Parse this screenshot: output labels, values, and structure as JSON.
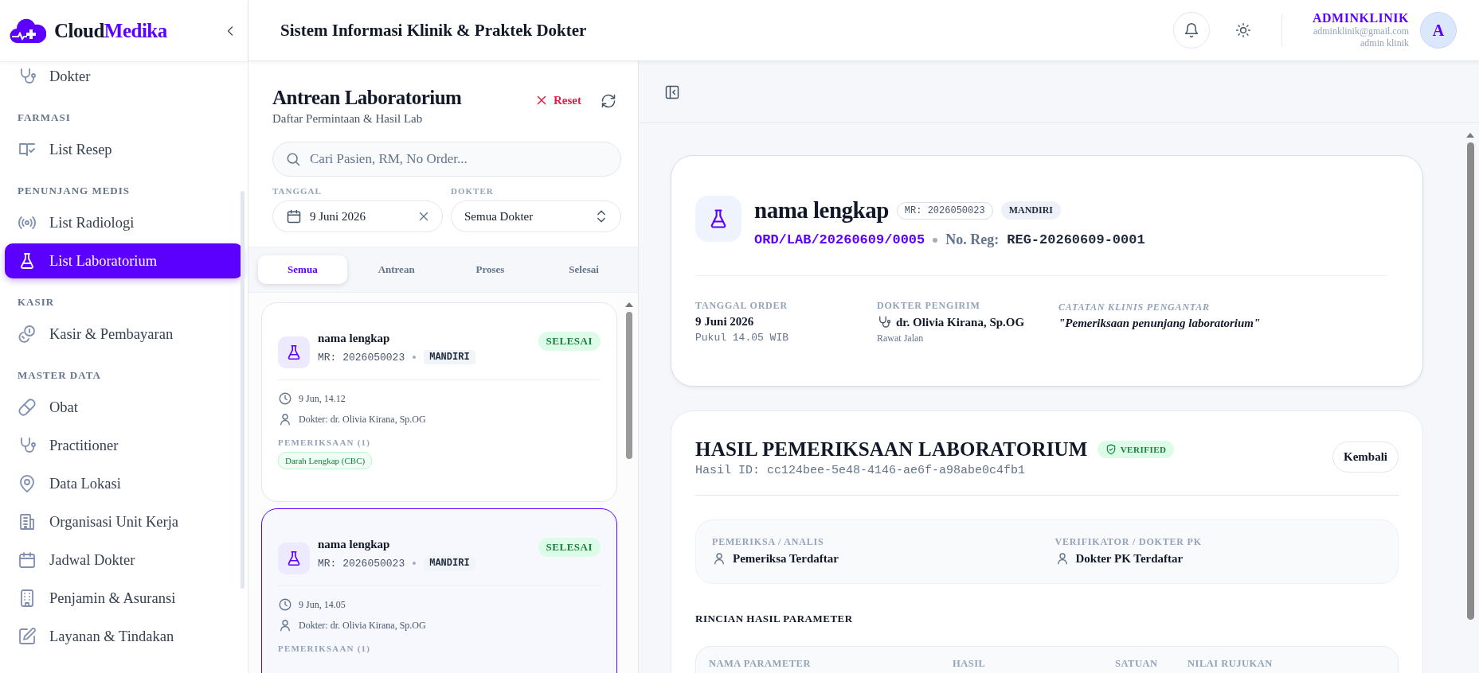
{
  "brand": {
    "name": "Cloud",
    "accent": "Medika"
  },
  "sidebar": {
    "sections": [
      {
        "items": [
          {
            "label": "Dokter",
            "selected": false
          }
        ]
      },
      {
        "heading": "FARMASI",
        "items": [
          {
            "label": "List Resep",
            "selected": false
          }
        ]
      },
      {
        "heading": "PENUNJANG MEDIS",
        "items": [
          {
            "label": "List Radiologi",
            "selected": false
          },
          {
            "label": "List Laboratorium",
            "selected": true
          }
        ]
      },
      {
        "heading": "KASIR",
        "items": [
          {
            "label": "Kasir & Pembayaran",
            "selected": false
          }
        ]
      },
      {
        "heading": "MASTER DATA",
        "items": [
          {
            "label": "Obat",
            "selected": false
          },
          {
            "label": "Practitioner",
            "selected": false
          },
          {
            "label": "Data Lokasi",
            "selected": false
          },
          {
            "label": "Organisasi Unit Kerja",
            "selected": false
          },
          {
            "label": "Jadwal Dokter",
            "selected": false
          },
          {
            "label": "Penjamin & Asuransi",
            "selected": false
          },
          {
            "label": "Layanan & Tindakan",
            "selected": false
          }
        ]
      }
    ]
  },
  "header": {
    "title": "Sistem Informasi Klinik & Praktek Dokter",
    "user": {
      "name": "ADMINKLINIK",
      "email": "adminklinik@gmail.com",
      "role": "admin klinik",
      "initial": "A"
    }
  },
  "queue": {
    "title": "Antrean Laboratorium",
    "subtitle": "Daftar Permintaan & Hasil Lab",
    "reset": "Reset",
    "search": {
      "placeholder": "Cari Pasien, RM, No Order..."
    },
    "filters": [
      {
        "kind": "date",
        "label": "TANGGAL",
        "value": "9 Juni 2026"
      },
      {
        "kind": "select",
        "label": "DOKTER",
        "value": "Semua Dokter"
      }
    ],
    "tabs": [
      {
        "label": "Semua",
        "selected": true
      },
      {
        "label": "Antrean",
        "selected": false
      },
      {
        "label": "Proses",
        "selected": false
      },
      {
        "label": "Selesai",
        "selected": false
      }
    ],
    "cards": [
      {
        "name": "nama lengkap",
        "mr": "MR: 2026050023",
        "payer": "MANDIRI",
        "status": "SELESAI",
        "time": "9 Jun, 14.12",
        "doctor": "Dokter: dr. Olivia Kirana, Sp.OG",
        "exams_heading": "PEMERIKSAAN (1)",
        "exams": [
          "Darah Lengkap (CBC)"
        ],
        "selected": false
      },
      {
        "name": "nama lengkap",
        "mr": "MR: 2026050023",
        "payer": "MANDIRI",
        "status": "SELESAI",
        "time": "9 Jun, 14.05",
        "doctor": "Dokter: dr. Olivia Kirana, Sp.OG",
        "exams_heading": "PEMERIKSAAN (1)",
        "selected": true
      }
    ]
  },
  "detail": {
    "patient": {
      "name": "nama lengkap",
      "mr": "MR: 2026050023",
      "payer": "MANDIRI",
      "order_no": "ORD/LAB/20260609/0005",
      "reg_label": "No. Reg:",
      "reg_no": "REG-20260609-0001",
      "fields": [
        {
          "kind": "date",
          "label": "TANGGAL ORDER",
          "value": "9 Juni 2026",
          "sub": "Pukul 14.05 WIB"
        },
        {
          "kind": "doctor",
          "label": "DOKTER PENGIRIM",
          "value": "dr. Olivia Kirana, Sp.OG",
          "sub": "Rawat Jalan"
        },
        {
          "kind": "note",
          "label": "CATATAN KLINIS PENGANTAR",
          "value": "\"Pemeriksaan penunjang laboratorium\""
        }
      ]
    },
    "result": {
      "title": "HASIL PEMERIKSAAN LABORATORIUM",
      "status": "VERIFIED",
      "verified": true,
      "result_id": "Hasil ID: cc124bee-5e48-4146-ae6f-a98abe0c4fb1",
      "back": "Kembali",
      "staff": [
        {
          "label": "PEMERIKSA / ANALIS",
          "name": "Pemeriksa Terdaftar"
        },
        {
          "label": "VERIFIKATOR / DOKTER PK",
          "name": "Dokter PK Terdaftar"
        }
      ],
      "params_heading": "RINCIAN HASIL PARAMETER",
      "table": {
        "columns": [
          "NAMA PARAMETER",
          "HASIL",
          "SATUAN",
          "NILAI RUJUKAN"
        ]
      }
    }
  }
}
